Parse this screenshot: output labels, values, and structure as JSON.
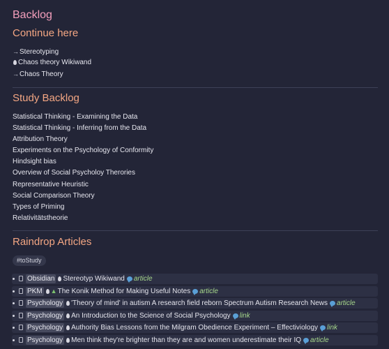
{
  "page": {
    "title": "Backlog"
  },
  "continue_section": {
    "heading": "Continue here",
    "items": [
      {
        "glyph": "→",
        "label": "Stereotyping"
      },
      {
        "glyph": "drop",
        "label": "Chaos theory Wikiwand"
      },
      {
        "glyph": "→",
        "label": "Chaos Theory"
      }
    ]
  },
  "study_section": {
    "heading": "Study Backlog",
    "items": [
      "Statistical Thinking - Examining the Data",
      "Statistical Thinking - Inferring from the Data",
      "Attribution Theory",
      "Experiments on the Psychology of Conformity",
      "Hindsight bias",
      "Overview of Social Psycholoy Therories",
      "Representative Heuristic",
      "Social Comparison Theory",
      "Types of Priming",
      "Relativitätstheorie"
    ]
  },
  "raindrop_section": {
    "heading": "Raindrop Articles",
    "tag": "#toStudy",
    "articles": [
      {
        "category": "Obsidian",
        "icon": "drop",
        "title": "Stereotyp Wikiwand",
        "kind": "article"
      },
      {
        "category": "PKM",
        "icon": "drop-tree",
        "title": "The Konik Method for Making Useful Notes",
        "kind": "article"
      },
      {
        "category": "Psychology",
        "icon": "drop",
        "title": "'Theory of mind' in autism A research field reborn Spectrum Autism Research News",
        "kind": "article"
      },
      {
        "category": "Psychology",
        "icon": "drop",
        "title": "An Introduction to the Science of Social Psychology",
        "kind": "link"
      },
      {
        "category": "Psychology",
        "icon": "drop",
        "title": "Authority Bias Lessons from the Milgram Obedience Experiment – Effectiviology",
        "kind": "link"
      },
      {
        "category": "Psychology",
        "icon": "drop",
        "title": "Men think they're brighter than they are and women underestimate their IQ",
        "kind": "article"
      }
    ]
  },
  "colors": {
    "background": "#232537",
    "title": "#f49fbc",
    "heading": "#f3a683",
    "kind_label": "#a6d78b",
    "comment_icon": "#5a9fd6"
  }
}
